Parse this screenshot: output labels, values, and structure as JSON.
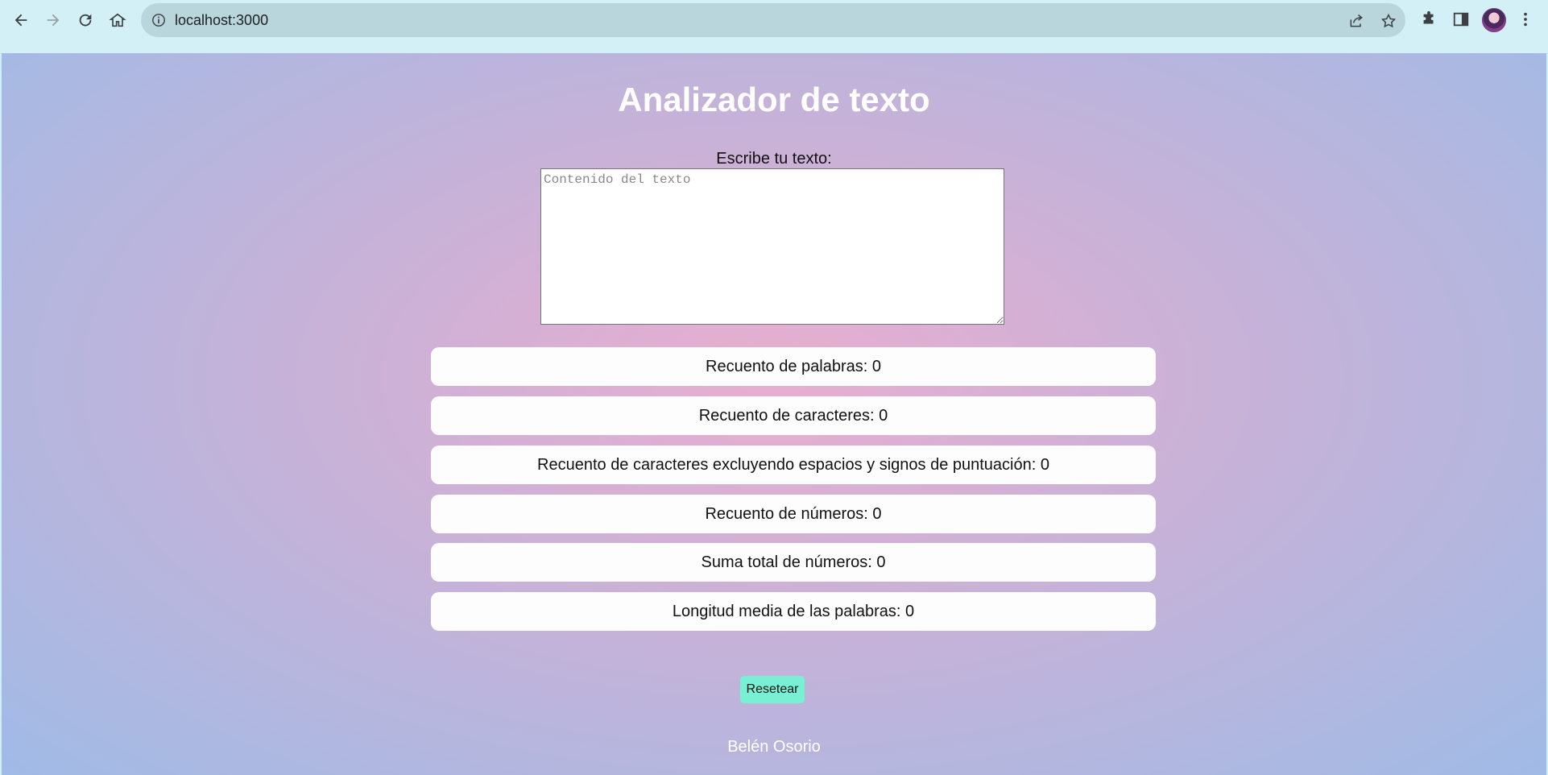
{
  "browser": {
    "url": "localhost:3000",
    "icons": [
      "back-arrow-icon",
      "forward-arrow-icon",
      "reload-icon",
      "home-icon",
      "info-icon",
      "share-icon",
      "star-icon",
      "extensions-icon",
      "side-panel-icon",
      "profile-avatar",
      "more-vert-icon"
    ]
  },
  "page": {
    "title": "Analizador de texto",
    "input_label": "Escribe tu texto:",
    "textarea_placeholder": "Contenido del texto",
    "textarea_value": "",
    "stats": [
      "Recuento de palabras: 0",
      "Recuento de caracteres: 0",
      "Recuento de caracteres excluyendo espacios y signos de puntuación: 0",
      "Recuento de números: 0",
      "Suma total de números: 0",
      "Longitud media de las palabras: 0"
    ],
    "reset_label": "Resetear",
    "footer": "Belén Osorio"
  },
  "colors": {
    "title": "#ffffff",
    "reset_button": "#79f0d4",
    "stat_background": "#fdfdfd",
    "gradient_center": "#e8aecf",
    "gradient_edge": "#9fbbe6"
  }
}
